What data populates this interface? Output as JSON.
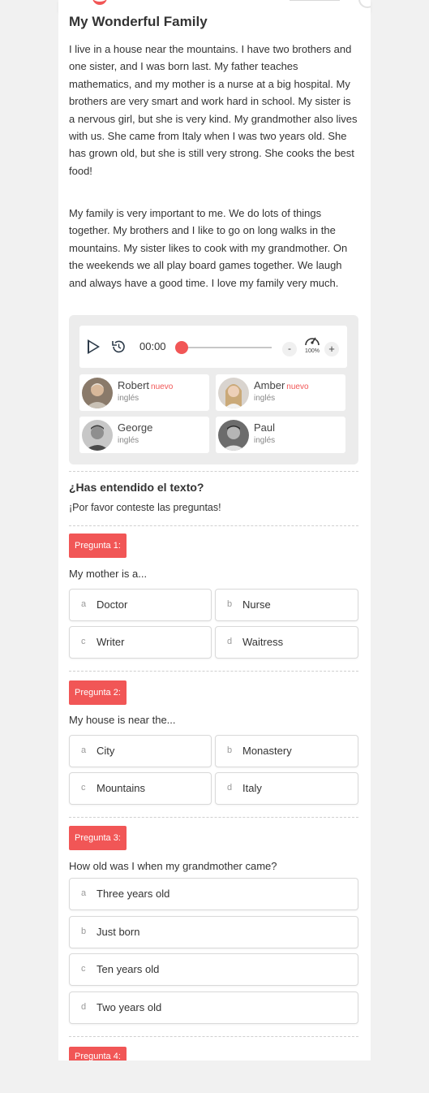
{
  "story": {
    "title": "My Wonderful Family",
    "paragraph1": "I live in a house near the mountains. I have two brothers and one sister, and I was born last. My father teaches mathematics, and my mother is a nurse at a big hospital. My brothers are very smart and work hard in school. My sister is a nervous girl, but she is very kind. My grandmother also lives with us. She came from Italy when I was two years old. She has grown old, but she is still very strong. She cooks the best food!",
    "paragraph2": "My family is very important to me. We do lots of things together. My brothers and I like to go on long walks in the mountains. My sister likes to cook with my grandmother. On the weekends we all play board games together. We laugh and always have a good time. I love my family very much."
  },
  "player": {
    "time": "00:00",
    "progress": 0,
    "minus_label": "-",
    "plus_label": "+",
    "speed": "100%",
    "accent_color": "#f15656"
  },
  "voices": [
    {
      "name": "Robert",
      "badge": "nuevo",
      "language": "inglés"
    },
    {
      "name": "Amber",
      "badge": "nuevo",
      "language": "inglés"
    },
    {
      "name": "George",
      "badge": "",
      "language": "inglés"
    },
    {
      "name": "Paul",
      "badge": "",
      "language": "inglés"
    }
  ],
  "quiz": {
    "heading": "¿Has entendido el texto?",
    "subheading": "¡Por favor conteste las preguntas!",
    "questions": [
      {
        "badge": "Pregunta 1:",
        "text": "My mother is a...",
        "options": [
          {
            "letter": "a",
            "text": "Doctor"
          },
          {
            "letter": "b",
            "text": "Nurse"
          },
          {
            "letter": "c",
            "text": "Writer"
          },
          {
            "letter": "d",
            "text": "Waitress"
          }
        ]
      },
      {
        "badge": "Pregunta 2:",
        "text": "My house is near the...",
        "options": [
          {
            "letter": "a",
            "text": "City"
          },
          {
            "letter": "b",
            "text": "Monastery"
          },
          {
            "letter": "c",
            "text": "Mountains"
          },
          {
            "letter": "d",
            "text": "Italy"
          }
        ]
      },
      {
        "badge": "Pregunta 3:",
        "text": "How old was I when my grandmother came?",
        "options": [
          {
            "letter": "a",
            "text": "Three years old"
          },
          {
            "letter": "b",
            "text": "Just born"
          },
          {
            "letter": "c",
            "text": "Ten years old"
          },
          {
            "letter": "d",
            "text": "Two years old"
          }
        ]
      },
      {
        "badge": "Pregunta 4:"
      }
    ]
  }
}
